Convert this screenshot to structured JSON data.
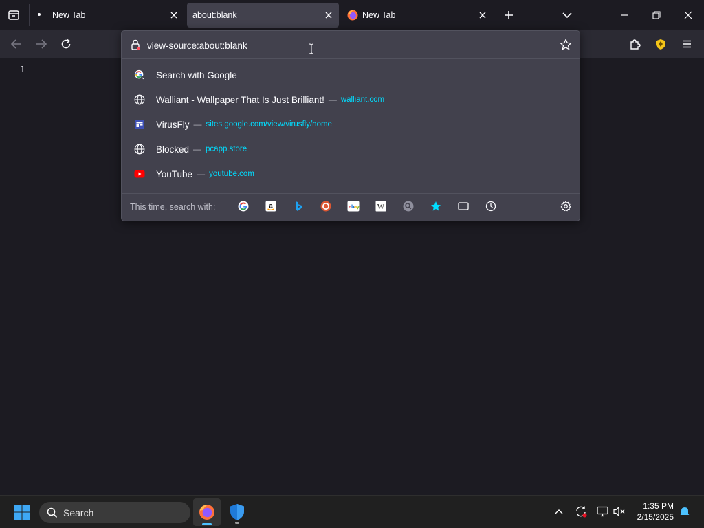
{
  "tabs": [
    {
      "label": "New Tab",
      "active": false,
      "icon": "dot"
    },
    {
      "label": "about:blank",
      "active": true,
      "icon": "none"
    },
    {
      "label": "New Tab",
      "active": false,
      "icon": "firefox-icon"
    }
  ],
  "urlbar": {
    "value": "view-source:about:blank",
    "icon": "page-warning-icon"
  },
  "content": {
    "line_number": "1"
  },
  "results": [
    {
      "title": "Search with Google",
      "url": "",
      "icon": "google-icon"
    },
    {
      "title": "Walliant - Wallpaper That Is Just Brilliant!",
      "url": "walliant.com",
      "icon": "globe-icon"
    },
    {
      "title": "VirusFly",
      "url": "sites.google.com/view/virusfly/home",
      "icon": "sites-icon"
    },
    {
      "title": "Blocked",
      "url": "pcapp.store",
      "icon": "globe-icon"
    },
    {
      "title": "YouTube",
      "url": "youtube.com",
      "icon": "youtube-icon"
    }
  ],
  "separator": "—",
  "oneoff": {
    "label": "This time, search with:",
    "engines": [
      "google-icon",
      "amazon-icon",
      "bing-icon",
      "duckduckgo-icon",
      "ebay-icon",
      "wikipedia-icon",
      "search-engine-icon",
      "bookmarks-icon",
      "tabs-icon",
      "history-icon"
    ]
  },
  "taskbar": {
    "search_label": "Search",
    "time": "1:35 PM",
    "date": "2/15/2025"
  },
  "colors": {
    "accent_link": "#00ddff",
    "popup_bg": "#42414d",
    "nav_bg": "#2b2a33",
    "content_bg": "#1c1b22"
  }
}
